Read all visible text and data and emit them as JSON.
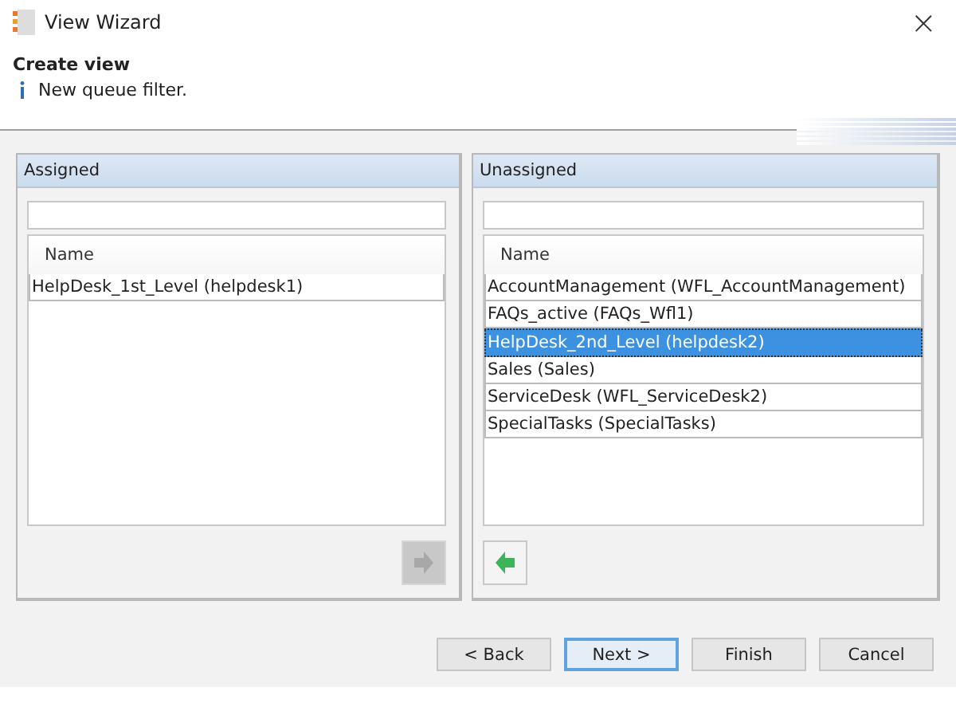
{
  "window": {
    "title": "View Wizard",
    "close": "×"
  },
  "header": {
    "title": "Create view",
    "message": "New queue filter."
  },
  "panels": [
    {
      "title": "Assigned",
      "column": "Name",
      "rows": [
        {
          "label": "HelpDesk_1st_Level (helpdesk1)",
          "selected": false
        }
      ],
      "move": {
        "kind": "right",
        "disabled": true
      }
    },
    {
      "title": "Unassigned",
      "column": "Name",
      "rows": [
        {
          "label": "AccountManagement (WFL_AccountManagement)",
          "selected": false
        },
        {
          "label": "FAQs_active (FAQs_Wfl1)",
          "selected": false
        },
        {
          "label": "HelpDesk_2nd_Level (helpdesk2)",
          "selected": true
        },
        {
          "label": "Sales (Sales)",
          "selected": false
        },
        {
          "label": "ServiceDesk (WFL_ServiceDesk2)",
          "selected": false
        },
        {
          "label": "SpecialTasks (SpecialTasks)",
          "selected": false
        }
      ],
      "move": {
        "kind": "left",
        "disabled": false
      }
    }
  ],
  "buttons": [
    {
      "label": "< Back",
      "focused": false
    },
    {
      "label": "Next >",
      "focused": true
    },
    {
      "label": "Finish",
      "focused": false
    },
    {
      "label": "Cancel",
      "focused": false
    }
  ]
}
